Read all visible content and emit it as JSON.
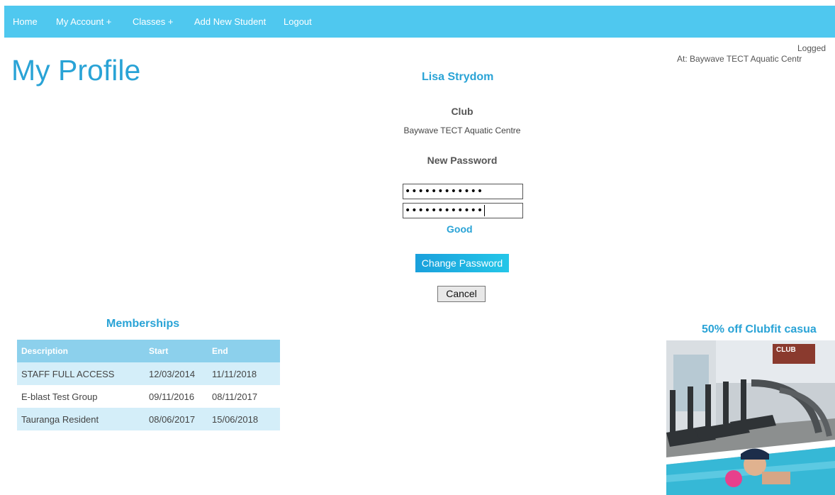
{
  "nav": {
    "items": [
      "Home",
      "My Account +",
      "Classes +",
      "Add New Student",
      "Logout"
    ]
  },
  "header": {
    "title": "My Profile",
    "logged_in": "Logged",
    "logged_at": "At: Baywave TECT Aquatic Centr"
  },
  "profile": {
    "name": "Lisa Strydom",
    "club_label": "Club",
    "club_value": "Baywave TECT Aquatic Centre",
    "new_password_label": "New Password",
    "password_mask": "••••••••••••",
    "password_confirm_mask": "••••••••••••",
    "strength": "Good",
    "change_button": "Change Password",
    "cancel_button": "Cancel"
  },
  "memberships": {
    "title": "Memberships",
    "columns": [
      "Description",
      "Start",
      "End"
    ],
    "rows": [
      [
        "STAFF FULL ACCESS",
        "12/03/2014",
        "11/11/2018"
      ],
      [
        "E-blast Test Group",
        "09/11/2016",
        "08/11/2017"
      ],
      [
        "Tauranga Resident",
        "08/06/2017",
        "15/06/2018"
      ]
    ]
  },
  "promo": {
    "title": "50% off Clubfit casua",
    "sign_text": "CLUB"
  },
  "colors": {
    "nav_bg": "#4fc8ef",
    "accent": "#29a3d6",
    "table_header": "#8cd0ec",
    "table_row_alt": "#d4eef9"
  }
}
